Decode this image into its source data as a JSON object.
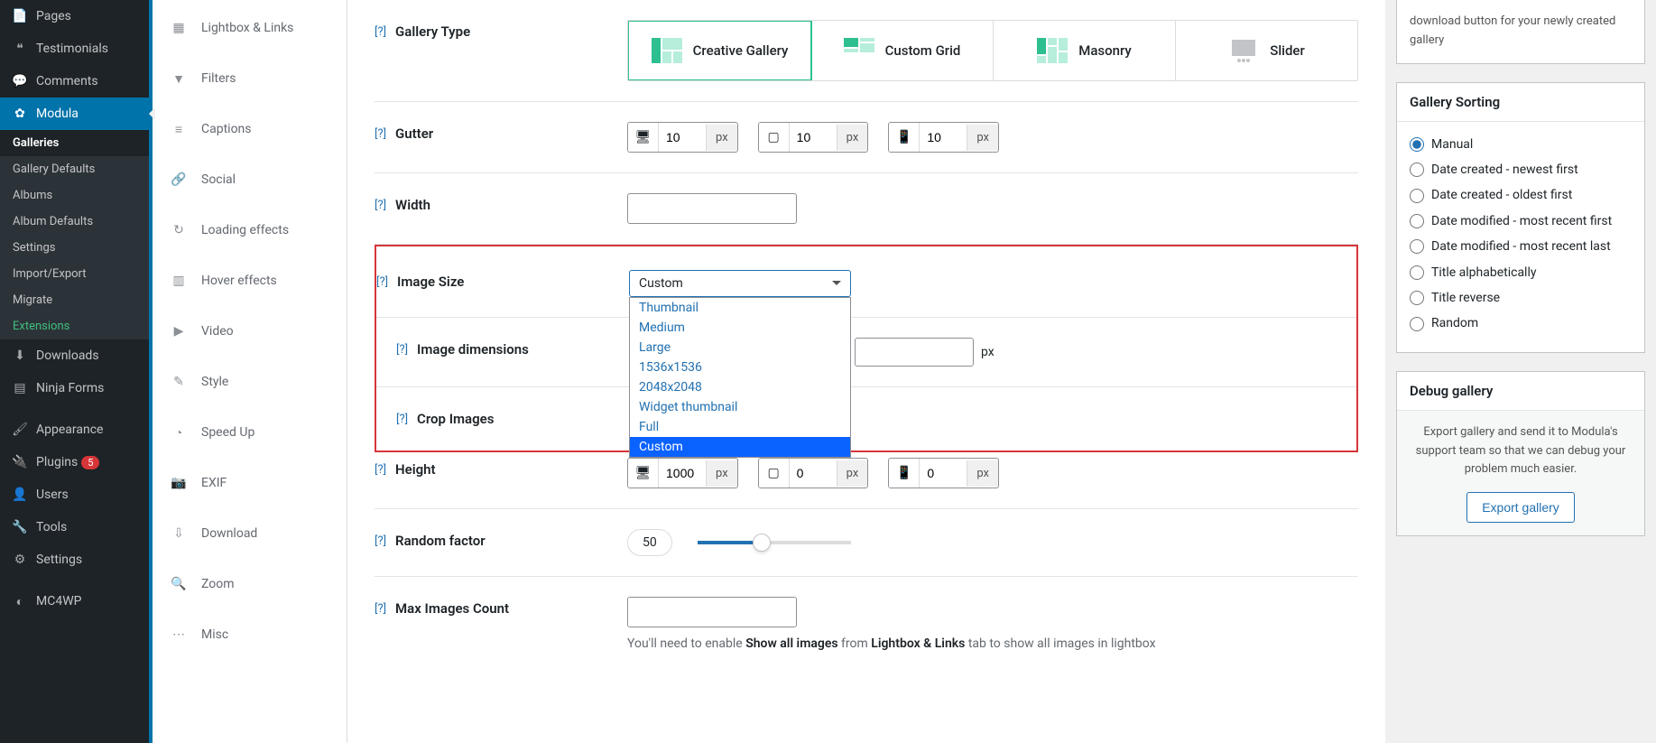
{
  "sidebar": {
    "items": [
      {
        "label": "Pages"
      },
      {
        "label": "Testimonials"
      },
      {
        "label": "Comments"
      },
      {
        "label": "Modula"
      },
      {
        "label": "Downloads"
      },
      {
        "label": "Ninja Forms"
      },
      {
        "label": "Appearance"
      },
      {
        "label": "Plugins",
        "badge": "5"
      },
      {
        "label": "Users"
      },
      {
        "label": "Tools"
      },
      {
        "label": "Settings"
      },
      {
        "label": "MC4WP"
      }
    ],
    "sub": [
      "Galleries",
      "Gallery Defaults",
      "Albums",
      "Album Defaults",
      "Settings",
      "Import/Export",
      "Migrate",
      "Extensions"
    ]
  },
  "subnav": [
    "Lightbox & Links",
    "Filters",
    "Captions",
    "Social",
    "Loading effects",
    "Hover effects",
    "Video",
    "Style",
    "Speed Up",
    "EXIF",
    "Download",
    "Zoom",
    "Misc"
  ],
  "form": {
    "gallery_type": {
      "label": "Gallery Type",
      "options": [
        "Creative Gallery",
        "Custom Grid",
        "Masonry",
        "Slider"
      ]
    },
    "gutter": {
      "label": "Gutter",
      "unit": "px",
      "values": [
        "10",
        "10",
        "10"
      ]
    },
    "width": {
      "label": "Width",
      "value": ""
    },
    "image_size": {
      "label": "Image Size",
      "selected": "Custom",
      "options": [
        "Thumbnail",
        "Medium",
        "Large",
        "1536x1536",
        "2048x2048",
        "Widget thumbnail",
        "Full",
        "Custom"
      ]
    },
    "image_dimensions": {
      "label": "Image dimensions",
      "unit": "px"
    },
    "crop": {
      "label": "Crop Images"
    },
    "height": {
      "label": "Height",
      "unit": "px",
      "values": [
        "1000",
        "0",
        "0"
      ]
    },
    "random": {
      "label": "Random factor",
      "value": "50"
    },
    "max_images": {
      "label": "Max Images Count",
      "value": "",
      "hint_pre": "You'll need to enable ",
      "hint_b1": "Show all images",
      "hint_mid": " from ",
      "hint_b2": "Lightbox & Links",
      "hint_post": " tab to show all images in lightbox"
    }
  },
  "right": {
    "shortcode_note": "download button for your newly created gallery",
    "sorting": {
      "title": "Gallery Sorting",
      "options": [
        "Manual",
        "Date created - newest first",
        "Date created - oldest first",
        "Date modified - most recent first",
        "Date modified - most recent last",
        "Title alphabetically",
        "Title reverse",
        "Random"
      ]
    },
    "debug": {
      "title": "Debug gallery",
      "text": "Export gallery and send it to Modula's support team so that we can debug your problem much easier.",
      "button": "Export gallery"
    }
  },
  "help": "[?]"
}
